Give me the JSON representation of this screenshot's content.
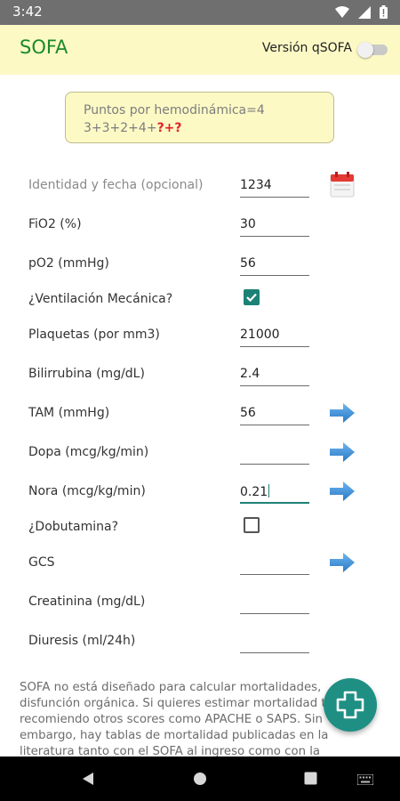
{
  "status_bar": {
    "time": "3:42"
  },
  "app_bar": {
    "title": "SOFA",
    "qsofa_label": "Versión qSOFA",
    "qsofa_on": false
  },
  "result": {
    "line1": "Puntos por hemodinámica=4",
    "line2_prefix": "3+3+2+4+",
    "line2_suffix": "?+?"
  },
  "form": {
    "identity": {
      "label": "Identidad y fecha (opcional)",
      "value": "1234"
    },
    "fio2": {
      "label": "FiO2 (%)",
      "value": "30"
    },
    "po2": {
      "label": "pO2 (mmHg)",
      "value": "56"
    },
    "ventilation": {
      "label": "¿Ventilación Mecánica?",
      "checked": true
    },
    "platelets": {
      "label": "Plaquetas (por mm3)",
      "value": "21000"
    },
    "bilirubin": {
      "label": "Bilirrubina (mg/dL)",
      "value": "2.4"
    },
    "tam": {
      "label": "TAM (mmHg)",
      "value": "56"
    },
    "dopa": {
      "label": "Dopa (mcg/kg/min)",
      "value": ""
    },
    "nora": {
      "label": "Nora (mcg/kg/min)",
      "value": "0.21"
    },
    "dobutamine": {
      "label": "¿Dobutamina?",
      "checked": false
    },
    "gcs": {
      "label": "GCS",
      "value": ""
    },
    "creatinine": {
      "label": "Creatinina (mg/dL)",
      "value": ""
    },
    "diuresis": {
      "label": "Diuresis (ml/24h)",
      "value": ""
    }
  },
  "footer_text": "SOFA no está diseñado para calcular mortalidades, disfunción orgánica. Si quieres estimar mortalidad te recomiendo otros scores como APACHE o SAPS. Sin embargo, hay tablas de mortalidad publicadas en la literatura tanto con el SOFA al ingreso como con la",
  "colors": {
    "app_bar_bg": "#fcf9c5",
    "title_green": "#1a8a2a",
    "accent_teal": "#1d8276",
    "arrow_blue": "#3a8fd6",
    "result_red": "#e3212a"
  }
}
